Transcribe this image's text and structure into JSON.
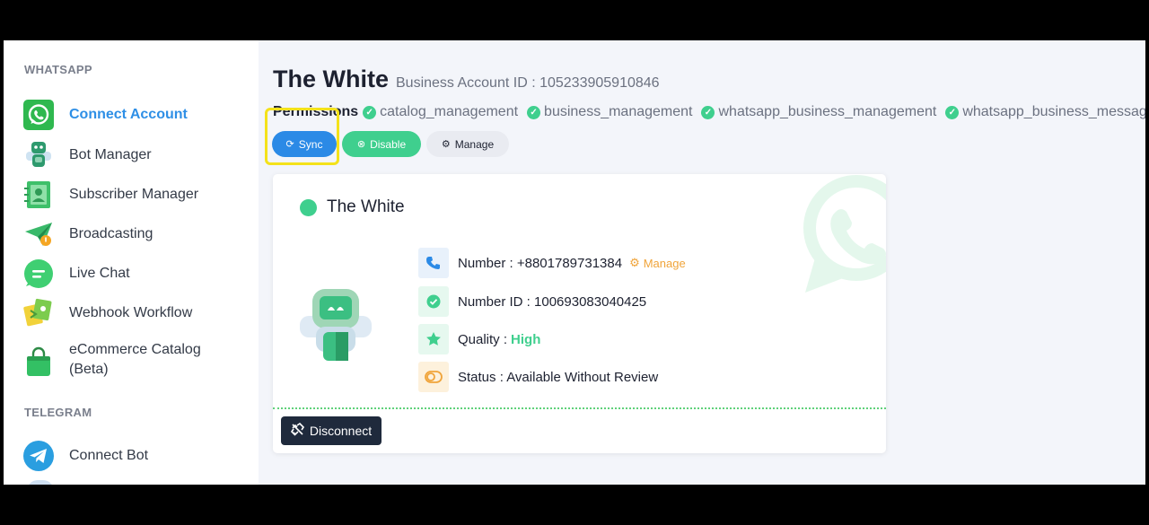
{
  "sidebar": {
    "whatsapp_title": "WHATSAPP",
    "whatsapp_items": [
      {
        "label": "Connect Account",
        "icon": "whatsapp-icon"
      },
      {
        "label": "Bot Manager",
        "icon": "robot-icon"
      },
      {
        "label": "Subscriber Manager",
        "icon": "subscriber-icon"
      },
      {
        "label": "Broadcasting",
        "icon": "paper-plane-icon"
      },
      {
        "label": "Live Chat",
        "icon": "chat-icon"
      },
      {
        "label": "Webhook Workflow",
        "icon": "workflow-icon"
      },
      {
        "label": "eCommerce Catalog",
        "label2": "(Beta)",
        "icon": "shopping-bag-icon"
      }
    ],
    "telegram_title": "TELEGRAM",
    "telegram_items": [
      {
        "label": "Connect Bot",
        "icon": "telegram-icon"
      }
    ]
  },
  "header": {
    "title": "The White",
    "account_id": "Business Account ID : 105233905910846"
  },
  "permissions": {
    "label": "Permissions",
    "items": [
      "catalog_management",
      "business_management",
      "whatsapp_business_management",
      "whatsapp_business_messaging"
    ]
  },
  "actions": {
    "sync": "Sync",
    "disable": "Disable",
    "manage": "Manage"
  },
  "card": {
    "name": "The White",
    "number": "Number : +8801789731384",
    "manage_link": "Manage",
    "number_id": "Number ID : 100693083040425",
    "quality_label": "Quality :",
    "quality_value": "High",
    "status": "Status : Available Without Review",
    "disconnect": "Disconnect"
  },
  "colors": {
    "accent_blue": "#2b8ae6",
    "accent_green": "#3fcf8e",
    "manage_orange": "#f0a43a",
    "dark_button": "#1f2a3c"
  }
}
